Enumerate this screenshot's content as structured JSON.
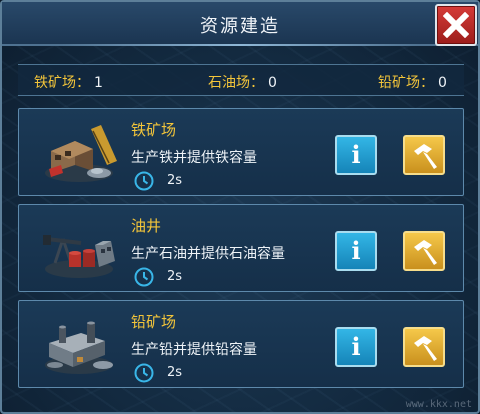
{
  "window": {
    "title": "资源建造"
  },
  "counts": [
    {
      "label": "铁矿场：",
      "value": "1"
    },
    {
      "label": "石油场：",
      "value": "0"
    },
    {
      "label": "铅矿场：",
      "value": "0"
    }
  ],
  "buildings": [
    {
      "name": "铁矿场",
      "description": "生产铁并提供铁容量",
      "time": "2s",
      "icon": "iron-mine-icon"
    },
    {
      "name": "油井",
      "description": "生产石油并提供石油容量",
      "time": "2s",
      "icon": "oil-well-icon"
    },
    {
      "name": "铅矿场",
      "description": "生产铅并提供铅容量",
      "time": "2s",
      "icon": "lead-mine-icon"
    }
  ],
  "buttons": {
    "info_label": "i"
  },
  "watermark": "www.kkx.net",
  "colors": {
    "accent_yellow": "#f3c53a",
    "info_blue": "#1f9fd6",
    "build_gold": "#e0a930",
    "close_red": "#c52d2a"
  }
}
